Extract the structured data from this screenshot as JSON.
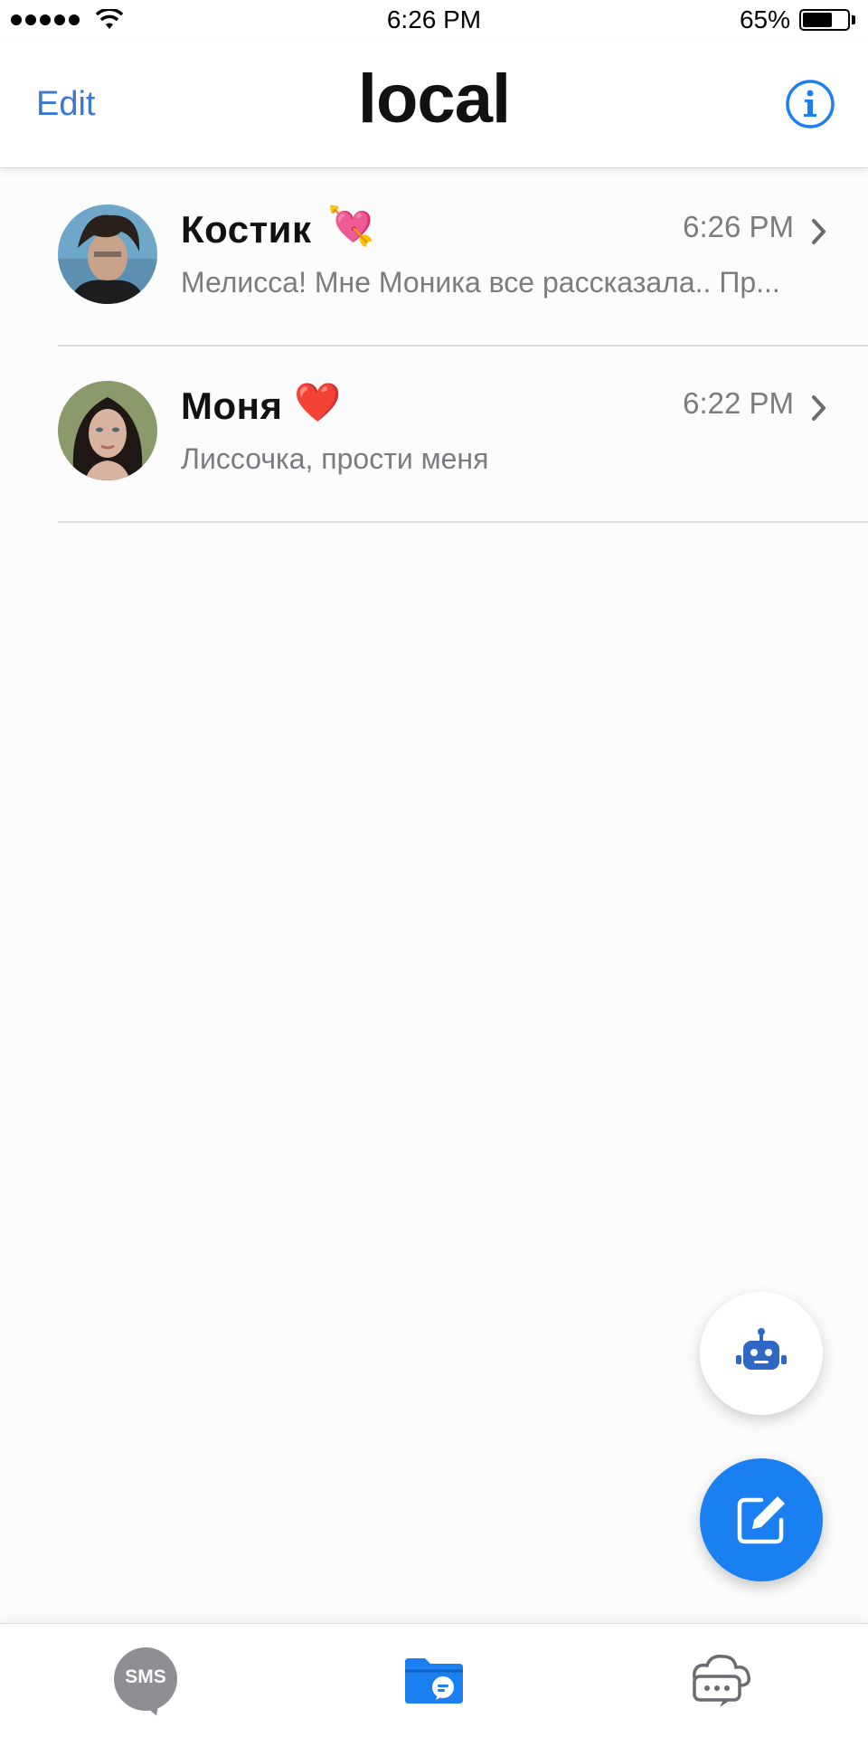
{
  "status_bar": {
    "time": "6:26 PM",
    "battery_percent": "65%",
    "battery_level": 0.65
  },
  "nav": {
    "edit_label": "Edit",
    "title": "local",
    "info_icon": "info-icon"
  },
  "conversations": [
    {
      "name": "Костик",
      "emoji": "💘",
      "time": "6:26 PM",
      "preview": "Мелисса! Мне Моника все рассказала.. Пр..."
    },
    {
      "name": "Моня",
      "emoji": "❤️",
      "time": "6:22 PM",
      "preview": "Лиссочка, прости меня"
    }
  ],
  "fabs": {
    "bot_icon": "robot-icon",
    "compose_icon": "compose-icon",
    "compose_color": "#1a7ff0"
  },
  "tab_bar": {
    "sms_label": "SMS",
    "folder_icon": "folder-chat-icon",
    "chats_icon": "cloud-chat-icon",
    "accent": "#1a7ff0"
  }
}
